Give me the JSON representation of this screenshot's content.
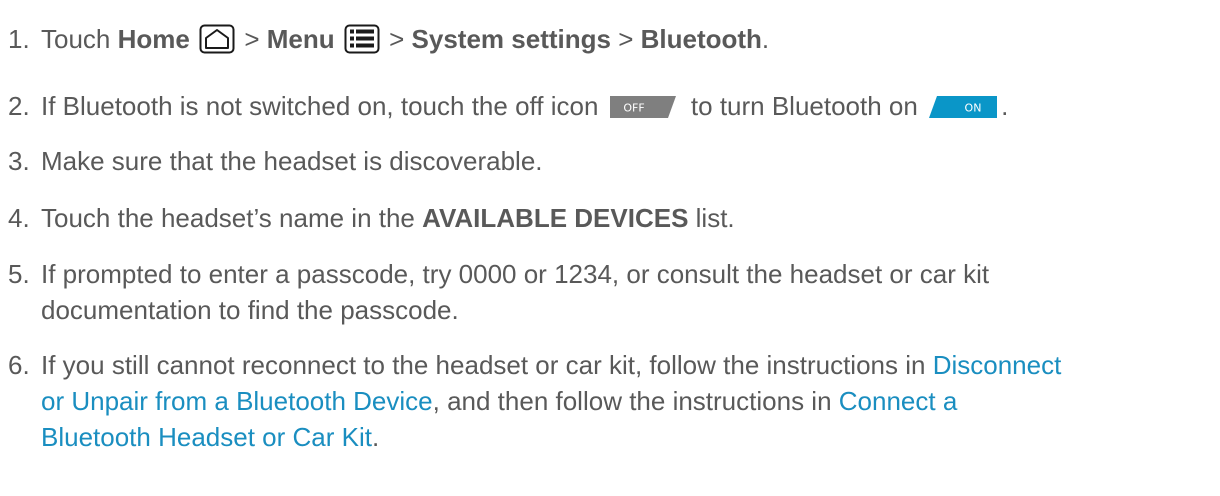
{
  "steps": [
    {
      "num": "1.",
      "touch": "Touch",
      "home": "Home",
      "sep1": ">",
      "menu": "Menu",
      "sep2": ">",
      "system_settings": "System settings",
      "sep3": ">",
      "bluetooth": "Bluetooth",
      "end": "."
    },
    {
      "num": "2.",
      "part1": "If Bluetooth is not switched on, touch the off icon",
      "off_label": "OFF",
      "part2": "to turn Bluetooth on",
      "on_label": "ON",
      "end": "."
    },
    {
      "num": "3.",
      "text": "Make sure that the headset is discoverable."
    },
    {
      "num": "4.",
      "part1": "Touch the headset’s name in the",
      "strong": "AVAILABLE DEVICES",
      "part2": "list."
    },
    {
      "num": "5.",
      "line1": "If prompted to enter a passcode, try 0000 or 1234, or consult the headset or car kit",
      "line2": "documentation to find the passcode."
    },
    {
      "num": "6.",
      "part1": "If you still cannot reconnect to the headset or car kit, follow the instructions in",
      "link1_a": "Disconnect",
      "link1_b": "or Unpair from a Bluetooth Device",
      "part2": ", and then follow the instructions in",
      "link2_a": "Connect a",
      "link2_b": "Bluetooth Headset or Car Kit",
      "end": "."
    }
  ],
  "colors": {
    "text": "#595959",
    "link": "#1a8ec0",
    "toggle_off": "#7f7f7f",
    "toggle_on": "#0a96c8"
  }
}
